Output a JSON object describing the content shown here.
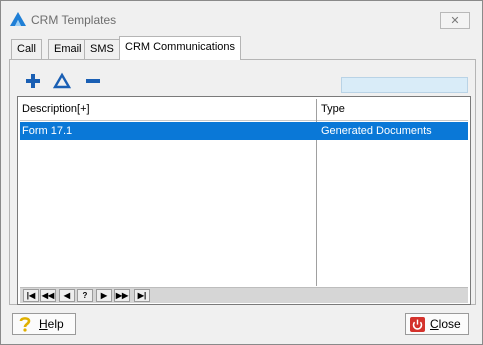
{
  "window": {
    "title": "CRM Templates"
  },
  "tabs": [
    {
      "label": "Call"
    },
    {
      "label": "Email"
    },
    {
      "label": "SMS"
    },
    {
      "label": "CRM Communications"
    }
  ],
  "toolbar": {
    "icons": [
      "add-icon",
      "edit-icon",
      "remove-icon"
    ],
    "search_value": ""
  },
  "grid": {
    "columns": [
      "Description[+]",
      "Type"
    ],
    "rows": [
      {
        "description": "Form 17.1",
        "type": "Generated Documents"
      }
    ],
    "navigator": [
      "|◀",
      "◀◀",
      "◀",
      "?",
      "▶",
      "▶▶",
      "▶|"
    ]
  },
  "footer": {
    "help_mnemonic": "H",
    "help_rest": "elp",
    "close_mnemonic": "C",
    "close_rest": "lose"
  },
  "colors": {
    "selection": "#0a78d7",
    "search_bg": "#d9ecf8",
    "accent_blue": "#1a5fb4"
  }
}
